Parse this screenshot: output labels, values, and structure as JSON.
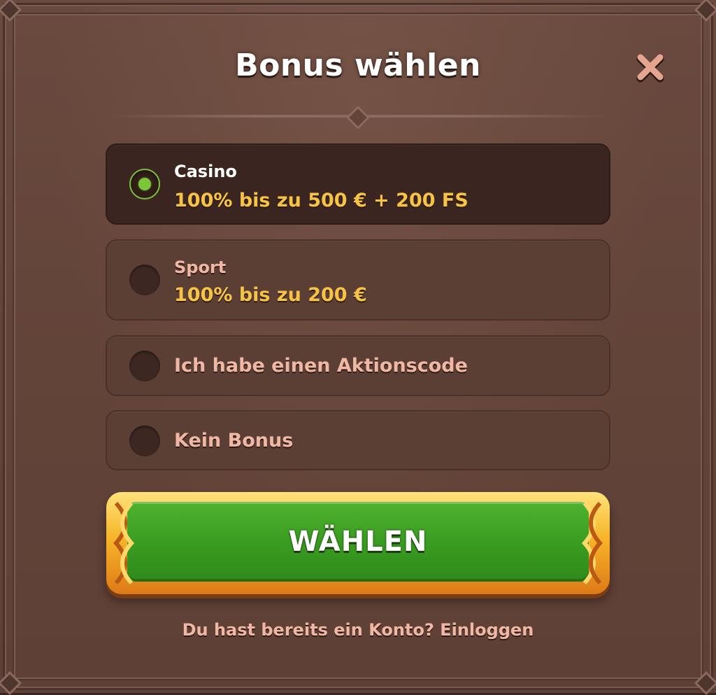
{
  "modal": {
    "title": "Bonus wählen",
    "close_icon": "close-icon"
  },
  "options": [
    {
      "label": "Casino",
      "desc": "100% bis zu 500 € + 200 FS",
      "selected": true
    },
    {
      "label": "Sport",
      "desc": "100% bis zu 200 €",
      "selected": false
    },
    {
      "label": "Ich habe einen Aktionscode",
      "selected": false
    },
    {
      "label": "Kein Bonus",
      "selected": false
    }
  ],
  "cta": {
    "label": "WÄHLEN"
  },
  "footer": {
    "question": "Du hast bereits ein Konto?",
    "login_link": "Einloggen"
  },
  "colors": {
    "accent_gold": "#f6c346",
    "button_green": "#3a9d22",
    "radio_on": "#7cc63a",
    "panel_brown": "#634439"
  }
}
